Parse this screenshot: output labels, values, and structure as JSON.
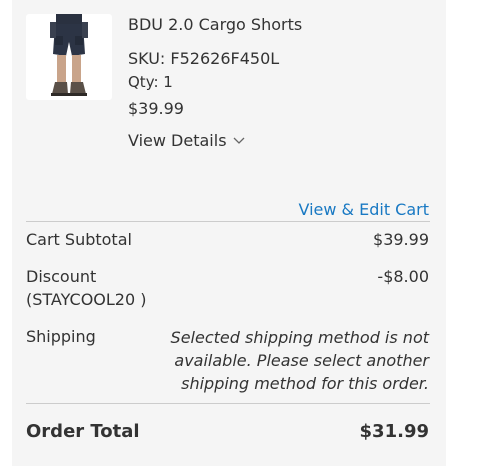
{
  "item": {
    "name": "BDU 2.0 Cargo Shorts",
    "sku": "SKU: F52626F450L",
    "qty": "Qty: 1",
    "price": "$39.99",
    "view_details": "View Details"
  },
  "cart": {
    "edit_link": "View & Edit Cart"
  },
  "summary": {
    "subtotal_label": "Cart Subtotal",
    "subtotal_value": "$39.99",
    "discount_label_line1": "Discount",
    "discount_label_line2": "(STAYCOOL20 )",
    "discount_value": "-$8.00",
    "shipping_label": "Shipping",
    "shipping_line1": "Selected shipping method is not",
    "shipping_line2": "available. Please select another",
    "shipping_line3": "shipping method for this order.",
    "total_label": "Order Total",
    "total_value": "$31.99"
  },
  "icons": {
    "view_details_toggle": "chevron-down-icon",
    "product_image": "cargo-shorts-thumbnail"
  },
  "colors": {
    "panel_bg": "#f5f5f5",
    "link": "#1979c3",
    "text": "#333333",
    "divider": "#cccccc"
  }
}
